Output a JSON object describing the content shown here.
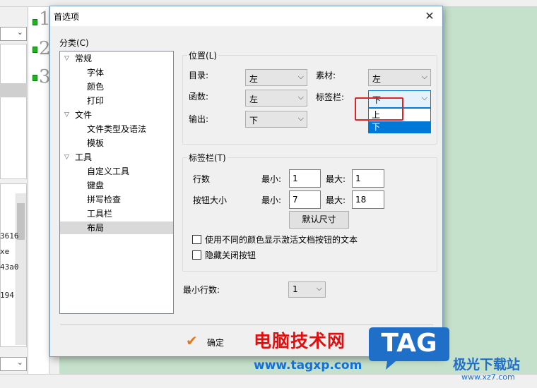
{
  "dialog": {
    "title": "首选项",
    "close_symbol": "✕",
    "category_label": "分类(C)",
    "ok_label": "确定"
  },
  "tree": [
    {
      "label": "常规",
      "expandable": true
    },
    {
      "label": "字体"
    },
    {
      "label": "颜色"
    },
    {
      "label": "打印"
    },
    {
      "label": "文件",
      "expandable": true
    },
    {
      "label": "文件类型及语法"
    },
    {
      "label": "模板"
    },
    {
      "label": "工具",
      "expandable": true
    },
    {
      "label": "自定义工具"
    },
    {
      "label": "键盘"
    },
    {
      "label": "拼写检查"
    },
    {
      "label": "工具栏"
    },
    {
      "label": "布局",
      "selected": true
    }
  ],
  "position_group": {
    "title": "位置(L)",
    "dir_label": "目录:",
    "dir_value": "左",
    "func_label": "函数:",
    "func_value": "左",
    "output_label": "输出:",
    "output_value": "下",
    "material_label": "素材:",
    "material_value": "左",
    "tabbar_label": "标签栏:",
    "tabbar_value": "下",
    "tabbar_options": [
      "上",
      "下"
    ]
  },
  "tabbar_group": {
    "title": "标签栏(T)",
    "rows_label": "行数",
    "btn_size_label": "按钮大小",
    "min_label": "最小:",
    "max_label": "最大:",
    "rows_min": "1",
    "rows_max": "1",
    "size_min": "7",
    "size_max": "18",
    "default_size_btn": "默认尺寸",
    "check_colors": "使用不同的颜色显示激活文档按钮的文本",
    "check_hide_close": "隐藏关闭按钮"
  },
  "min_rows": {
    "label": "最小行数:",
    "value": "1"
  },
  "background": {
    "left_fragments": [
      "3616",
      "xe",
      "43a0",
      "194"
    ],
    "line_numbers": [
      "1",
      "2",
      "3"
    ]
  },
  "watermarks": {
    "site_name": "电脑技术网",
    "site_url": "www.tagxp.com",
    "badge_text": "TAG",
    "badge_site": "极光下载站",
    "badge_url": "www.xz7.com"
  },
  "colors": {
    "accent": "#0078d7",
    "highlight_box": "#e02424",
    "background_green": "#c5e1cb"
  }
}
